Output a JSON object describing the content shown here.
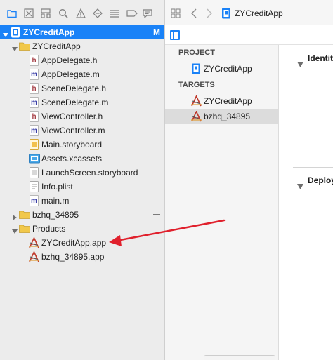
{
  "navigator": {
    "toolbar_icons": [
      "project-navigator-icon",
      "source-control-icon",
      "symbol-navigator-icon",
      "find-navigator-icon",
      "issue-navigator-icon",
      "test-navigator-icon",
      "debug-navigator-icon",
      "breakpoint-navigator-icon",
      "report-navigator-icon"
    ],
    "tree": [
      {
        "label": "ZYCreditApp",
        "kind": "project",
        "badge": "M",
        "selected": true
      },
      {
        "label": "ZYCreditApp",
        "kind": "folder"
      },
      {
        "label": "AppDelegate.h",
        "kind": "header-file",
        "glyph": "h"
      },
      {
        "label": "AppDelegate.m",
        "kind": "source-file",
        "glyph": "m"
      },
      {
        "label": "SceneDelegate.h",
        "kind": "header-file",
        "glyph": "h"
      },
      {
        "label": "SceneDelegate.m",
        "kind": "source-file",
        "glyph": "m"
      },
      {
        "label": "ViewController.h",
        "kind": "header-file",
        "glyph": "h"
      },
      {
        "label": "ViewController.m",
        "kind": "source-file",
        "glyph": "m"
      },
      {
        "label": "Main.storyboard",
        "kind": "storyboard-file"
      },
      {
        "label": "Assets.xcassets",
        "kind": "assets-file"
      },
      {
        "label": "LaunchScreen.storyboard",
        "kind": "storyboard-file"
      },
      {
        "label": "Info.plist",
        "kind": "plist-file"
      },
      {
        "label": "main.m",
        "kind": "source-file",
        "glyph": "m"
      },
      {
        "label": "bzhq_34895",
        "kind": "folder"
      },
      {
        "label": "Products",
        "kind": "folder"
      },
      {
        "label": "ZYCreditApp.app",
        "kind": "app-product"
      },
      {
        "label": "bzhq_34895.app",
        "kind": "app-product"
      }
    ]
  },
  "jump_bar": {
    "icons": [
      "related-items-icon",
      "back-arrow-icon",
      "forward-arrow-icon",
      "project-file-icon"
    ],
    "crumb": "ZYCreditApp"
  },
  "targets_pane": {
    "project_header": "PROJECT",
    "project_item": "ZYCreditApp",
    "targets_header": "TARGETS",
    "targets": [
      {
        "label": "ZYCreditApp",
        "selected": false
      },
      {
        "label": "bzhq_34895",
        "selected": true
      }
    ]
  },
  "settings": {
    "sections": [
      "Identit",
      "Deploy"
    ]
  },
  "colors": {
    "selection_blue": "#1a82f7",
    "arrow_red": "#e0202c",
    "folder_yellow": "#f1c84a"
  }
}
